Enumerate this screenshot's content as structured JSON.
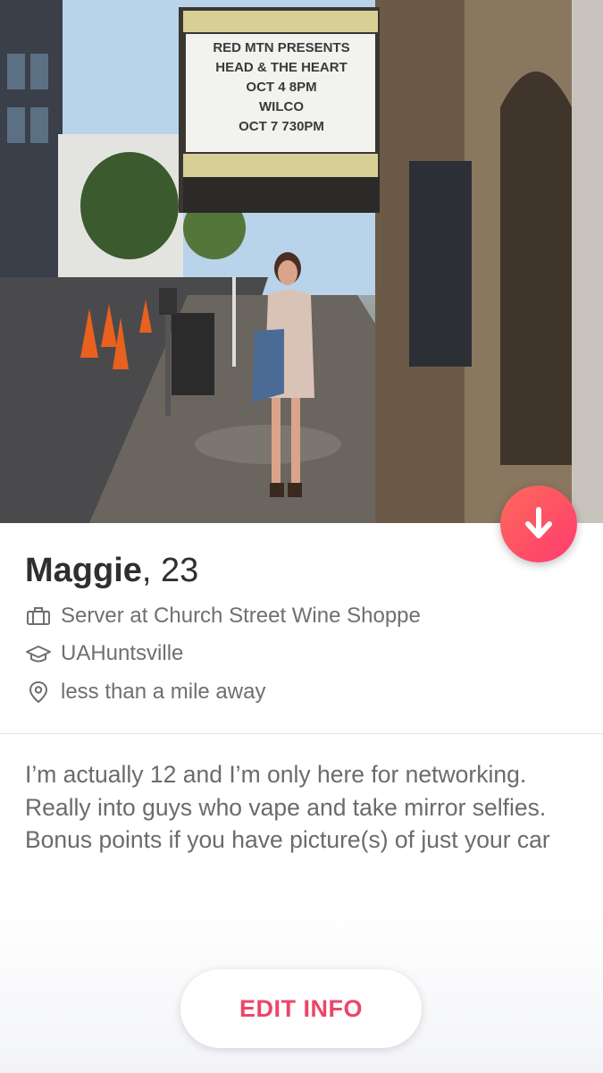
{
  "profile": {
    "name": "Maggie",
    "age_text": ", 23",
    "job": "Server at Church Street Wine Shoppe",
    "school": "UAHuntsville",
    "distance": "less than a mile away",
    "bio": "I’m actually 12 and I’m only here for networking. Really into guys who vape and take mirror selfies. Bonus points if you have picture(s) of just your car"
  },
  "photo": {
    "marquee_lines": [
      "RED MTN PRESENTS",
      "HEAD & THE HEART",
      "OCT 4 8PM",
      "WILCO",
      "OCT 7 730PM"
    ]
  },
  "icons": {
    "collapse": "arrow-down-icon",
    "job": "briefcase-icon",
    "school": "graduation-cap-icon",
    "location": "location-pin-icon"
  },
  "actions": {
    "edit_label": "EDIT INFO"
  },
  "colors": {
    "accent": "#fd3b6f",
    "accent_start": "#ff6a5a",
    "edit_text": "#ec4668",
    "name_text": "#2f2f2f",
    "meta_text": "#6f6f6f"
  }
}
